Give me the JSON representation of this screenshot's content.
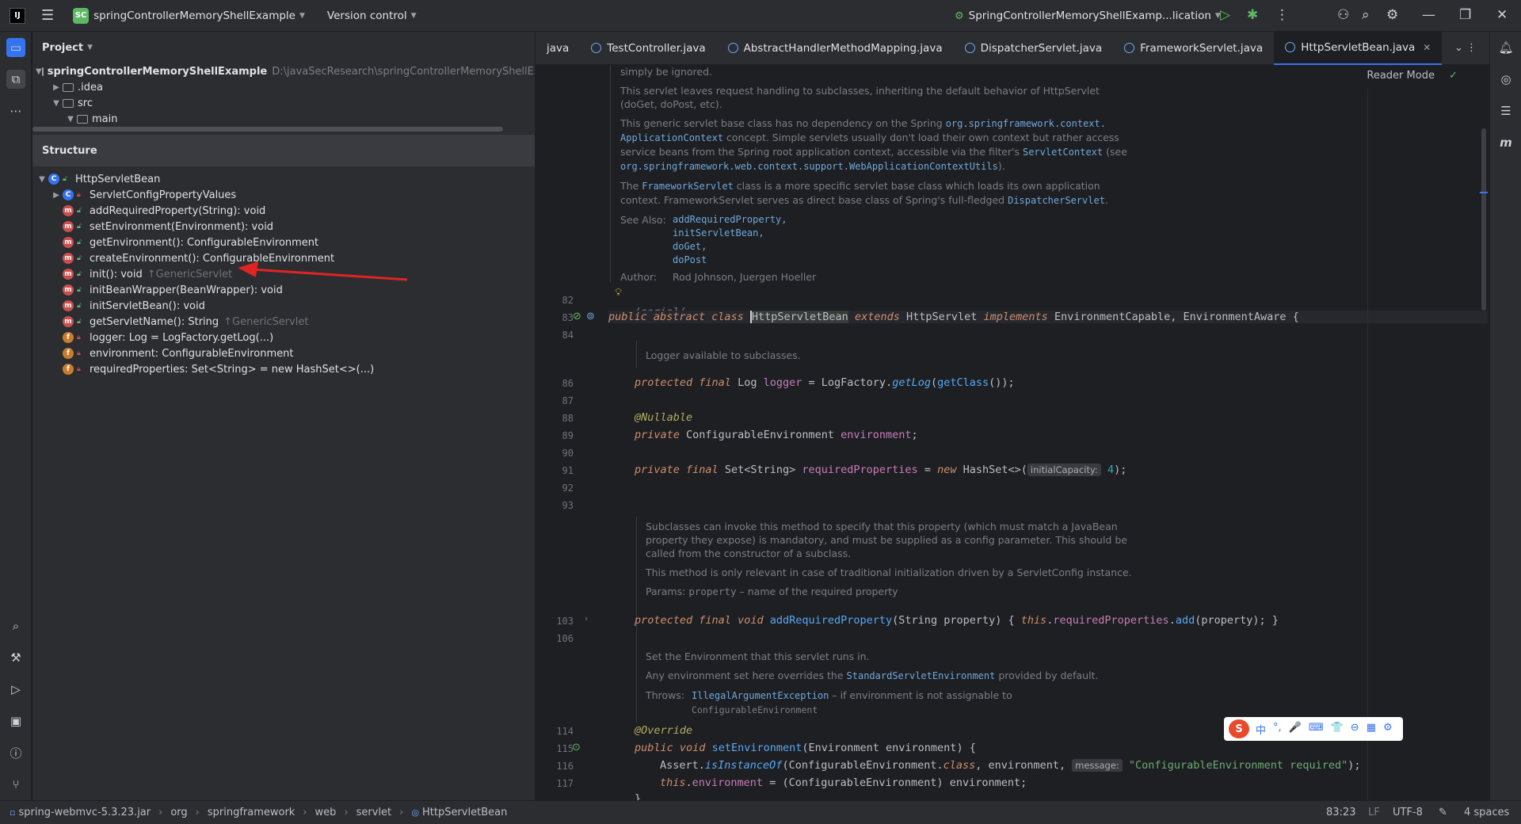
{
  "titlebar": {
    "logo": "IJ",
    "project_badge": "SC",
    "project_name": "springControllerMemoryShellExample",
    "version_control": "Version control",
    "run_config": "SpringControllerMemoryShellExamp...lication"
  },
  "project_panel": {
    "title": "Project",
    "tree": [
      {
        "label": "springControllerMemoryShellExample",
        "path": "D:\\javaSecResearch\\springControllerMemoryShellExamp"
      },
      {
        "label": ".idea",
        "path": ""
      },
      {
        "label": "src",
        "path": ""
      },
      {
        "label": "main",
        "path": ""
      }
    ]
  },
  "structure_panel": {
    "title": "Structure",
    "root": "HttpServletBean",
    "items": [
      {
        "kind": "c",
        "label": "ServletConfigPropertyValues",
        "hint": ""
      },
      {
        "kind": "m",
        "label": "addRequiredProperty(String): void",
        "hint": ""
      },
      {
        "kind": "m",
        "label": "setEnvironment(Environment): void",
        "hint": ""
      },
      {
        "kind": "m",
        "label": "getEnvironment(): ConfigurableEnvironment",
        "hint": ""
      },
      {
        "kind": "m",
        "label": "createEnvironment(): ConfigurableEnvironment",
        "hint": ""
      },
      {
        "kind": "m",
        "label": "init(): void",
        "hint": "↑GenericServlet"
      },
      {
        "kind": "m",
        "label": "initBeanWrapper(BeanWrapper): void",
        "hint": ""
      },
      {
        "kind": "m",
        "label": "initServletBean(): void",
        "hint": ""
      },
      {
        "kind": "m",
        "label": "getServletName(): String",
        "hint": "↑GenericServlet"
      },
      {
        "kind": "f",
        "label": "logger: Log = LogFactory.getLog(...)",
        "hint": ""
      },
      {
        "kind": "f",
        "label": "environment: ConfigurableEnvironment",
        "hint": ""
      },
      {
        "kind": "f",
        "label": "requiredProperties: Set<String> = new HashSet<>(...)",
        "hint": ""
      }
    ]
  },
  "tabs": [
    {
      "label": "java",
      "active": false
    },
    {
      "label": "TestController.java",
      "active": false
    },
    {
      "label": "AbstractHandlerMethodMapping.java",
      "active": false
    },
    {
      "label": "DispatcherServlet.java",
      "active": false
    },
    {
      "label": "FrameworkServlet.java",
      "active": false
    },
    {
      "label": "HttpServletBean.java",
      "active": true
    }
  ],
  "editor": {
    "reader_mode": "Reader Mode",
    "doc1": {
      "l0": "simply be ignored.",
      "l1": "This servlet leaves request handling to subclasses, inheriting the default behavior of HttpServlet",
      "l2": "(doGet, doPost, etc).",
      "l3a": "This generic servlet base class has no dependency on the Spring ",
      "l3b": "org.springframework.context.",
      "l4a": "ApplicationContext",
      "l4b": " concept. Simple servlets usually don't load their own context but rather access",
      "l5a": "service beans from the Spring root application context, accessible via the filter's ",
      "l5b": "ServletContext",
      "l5c": " (see",
      "l6a": "org.springframework.web.context.support.WebApplicationContextUtils",
      "l6b": ").",
      "l7a": "The ",
      "l7b": "FrameworkServlet",
      "l7c": " class is a more specific servlet base class which loads its own application",
      "l8a": "context. FrameworkServlet serves as direct base class of Spring's full-fledged ",
      "l8b": "DispatcherServlet",
      "l8c": ".",
      "see_label": "See Also:",
      "see1": "addRequiredProperty,",
      "see2": "initServletBean,",
      "see3": "doGet,",
      "see4": "doPost",
      "author_label": "Author:",
      "author": "Rod Johnson, Juergen Hoeller"
    },
    "doc_logger": "Logger available to subclasses.",
    "doc_add": {
      "l1": "Subclasses can invoke this method to specify that this property (which must match a JavaBean",
      "l2": "property they expose) is mandatory, and must be supplied as a config parameter. This should be",
      "l3": "called from the constructor of a subclass.",
      "l4": "This method is only relevant in case of traditional initialization driven by a ServletConfig instance.",
      "params_label": "Params:",
      "param": "property",
      "param_desc": " – name of the required property"
    },
    "doc_env": {
      "l1": "Set the Environment that this servlet runs in.",
      "l2a": "Any environment set here overrides the ",
      "l2b": "StandardServletEnvironment",
      "l2c": " provided by default.",
      "throws_label": "Throws:",
      "throws_ex": "IllegalArgumentException",
      "throws_desc": " – if environment is not assignable to",
      "throws_desc2": "ConfigurableEnvironment"
    },
    "line_numbers": {
      "n82": "82",
      "n83": "83",
      "n84": "84",
      "n86": "86",
      "n87": "87",
      "n88": "88",
      "n89": "89",
      "n90": "90",
      "n91": "91",
      "n92": "92",
      "n93": "93",
      "n103": "103",
      "n106": "106",
      "n114": "114",
      "n115": "115",
      "n116": "116",
      "n117": "117"
    },
    "code": {
      "serial": "/serial/",
      "kw_public": "public",
      "kw_abstract": "abstract",
      "kw_class": "class",
      "class_name": "HttpServletBean",
      "kw_extends": "extends",
      "super": "HttpServlet",
      "kw_implements": "implements",
      "iface": "EnvironmentCapable, EnvironmentAware {",
      "kw_protected": "protected",
      "kw_final": "final",
      "log_type": "Log",
      "logger": "logger",
      "eq": " = ",
      "logfactory": "LogFactory.",
      "getlog": "getLog",
      "getclass_open": "(",
      "getclass": "getClass",
      "getclass_close": "());",
      "nullable": "@Nullable",
      "kw_private": "private",
      "cenv": "ConfigurableEnvironment",
      "env": "environment",
      "semi": ";",
      "set_type": "Set<String>",
      "reqprops": "requiredProperties",
      "kw_new": "new",
      "hashset": "HashSet<>(",
      "hint_ic": "initialCapacity:",
      "four": "4",
      "close_semi": ");",
      "kw_void": "void",
      "addreq": "addRequiredProperty",
      "add_params": "(String property) { ",
      "kw_this": "this",
      "dot": ".",
      "add": "add",
      "add_end": "(property); }",
      "override": "@Override",
      "setenv": "setEnvironment",
      "setenv_params": "(Environment environment) {",
      "assert": "Assert.",
      "isinst": "isInstanceOf",
      "isinst_args": "(ConfigurableEnvironment.",
      "kw_class2": "class",
      "comma_env": ", environment, ",
      "hint_msg": "message:",
      "msg": "\"ConfigurableEnvironment required\"",
      "assign": " = (ConfigurableEnvironment) environment;",
      "brace": "}"
    }
  },
  "ime": {
    "logo": "S",
    "items": [
      "中",
      "°,",
      "🎤",
      "⌨",
      "👕",
      "⊖",
      "▦",
      "⚙"
    ]
  },
  "statusbar": {
    "crumbs": [
      "spring-webmvc-5.3.23.jar",
      "org",
      "springframework",
      "web",
      "servlet",
      "HttpServletBean"
    ],
    "position": "83:23",
    "line_sep": "LF",
    "encoding": "UTF-8",
    "indent": "4 spaces"
  }
}
